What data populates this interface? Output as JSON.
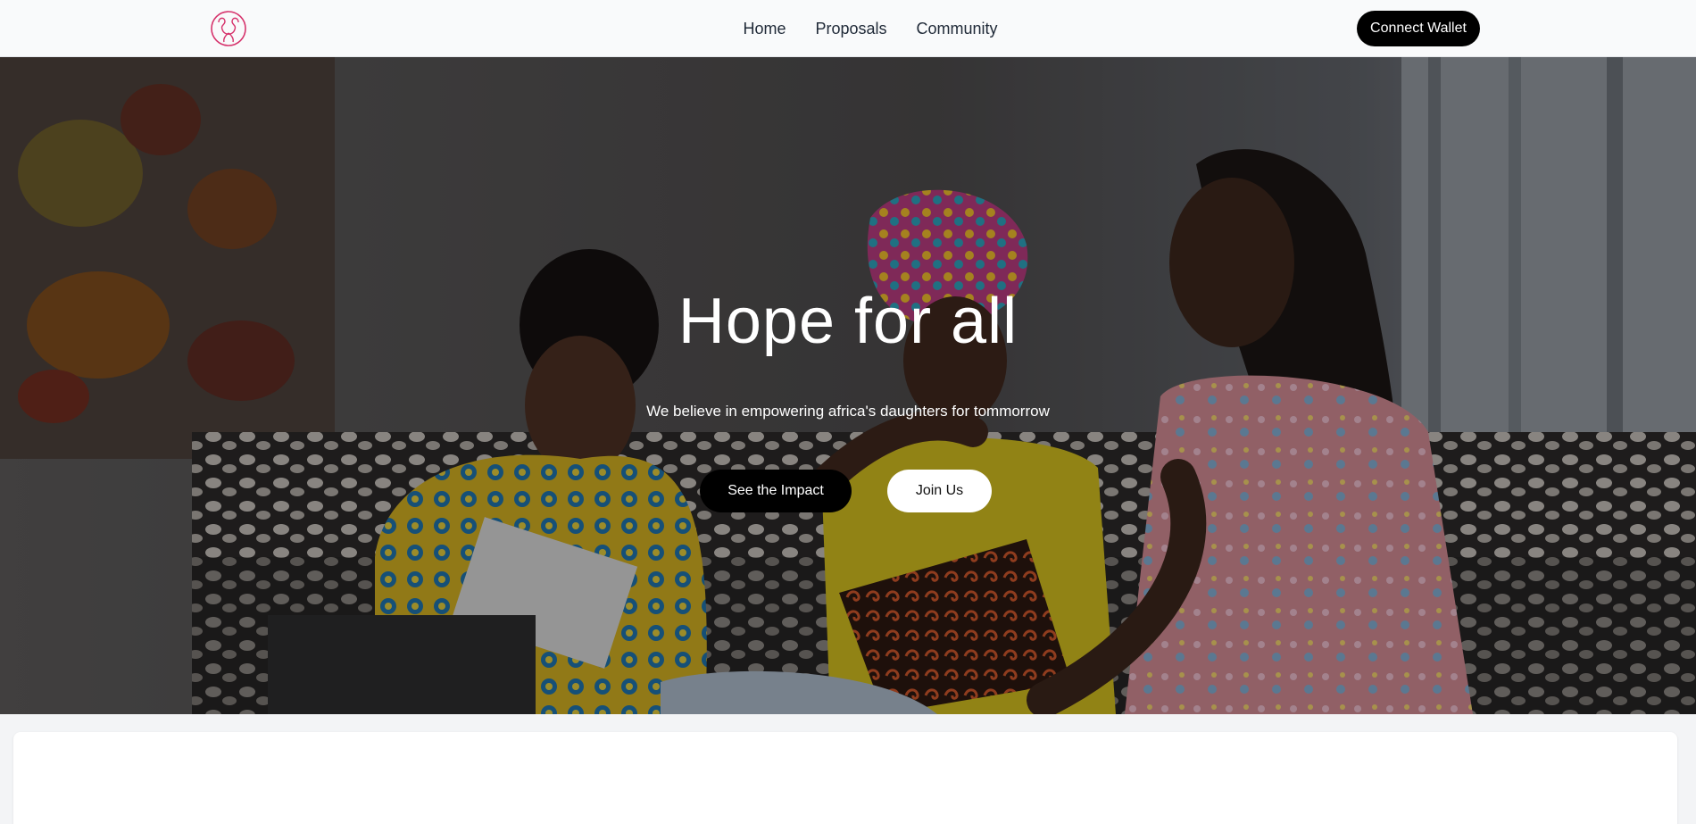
{
  "nav": {
    "logo_icon": "uterus-heart-logo-icon",
    "links": [
      "Home",
      "Proposals",
      "Community"
    ],
    "connect_label": "Connect Wallet"
  },
  "hero": {
    "title": "Hope for all",
    "subtitle": "We believe in empowering africa's daughters for tommorrow",
    "primary_button": "See the Impact",
    "secondary_button": "Join Us",
    "image_description_icon": "three-women-meeting-photo"
  },
  "colors": {
    "accent_logo": "#d6336c",
    "button_dark": "#000000",
    "button_light": "#ffffff"
  }
}
